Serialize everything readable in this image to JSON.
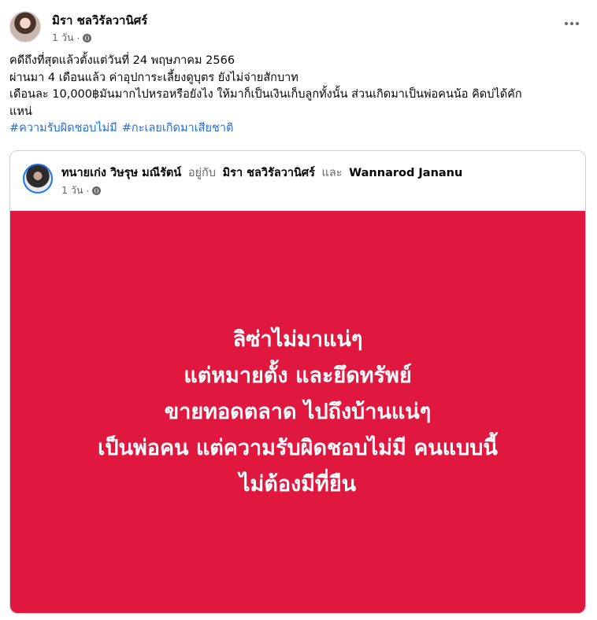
{
  "post": {
    "author": "มิรา ชลวิรัลวานิศร์",
    "time": "1 วัน",
    "privacy_icon": "globe-icon",
    "lines": [
      "คดีถึงที่สุดแล้วตั้งแต่วันที่ 24 พฤษภาคม 2566",
      "ผ่านมา 4 เดือนแล้ว ค่าอุปการะเลี้ยงดูบุตร ยังไม่จ่ายสักบาท",
      "เดือนละ 10,000฿มันมากไปหรอหรือยังไง ให้มาก็เป็นเงินเก็บลูกทั้งนั้น ส่วนเกิดมาเป็นพ่อคนน้อ คิดบ่ได้คัก",
      "แหน่"
    ],
    "hashtags": [
      "#ความรับผิดชอบไม่มี",
      "#กะเลยเกิดมาเสียชาติ"
    ],
    "more_icon": "more-horizontal-icon"
  },
  "shared": {
    "author": "ทนายเก่ง วิษรุษ มณีรัตน์",
    "with_text": "อยู่กับ",
    "tag1": "มิรา ชลวิรัลวานิศร์",
    "and_text": "และ",
    "tag2": "Wannarod Jananu",
    "time": "1 วัน",
    "banner_color": "#e0173f",
    "banner_lines": [
      "ลิซ่าไม่มาแน่ๆ",
      "แต่หมายตั้ง และยึดทรัพย์",
      "ขายทอดตลาด ไปถึงบ้านแน่ๆ",
      "เป็นพ่อคน แต่ความรับผิดชอบไม่มี คนแบบนี้",
      "ไม่ต้องมีที่ยืน"
    ]
  }
}
